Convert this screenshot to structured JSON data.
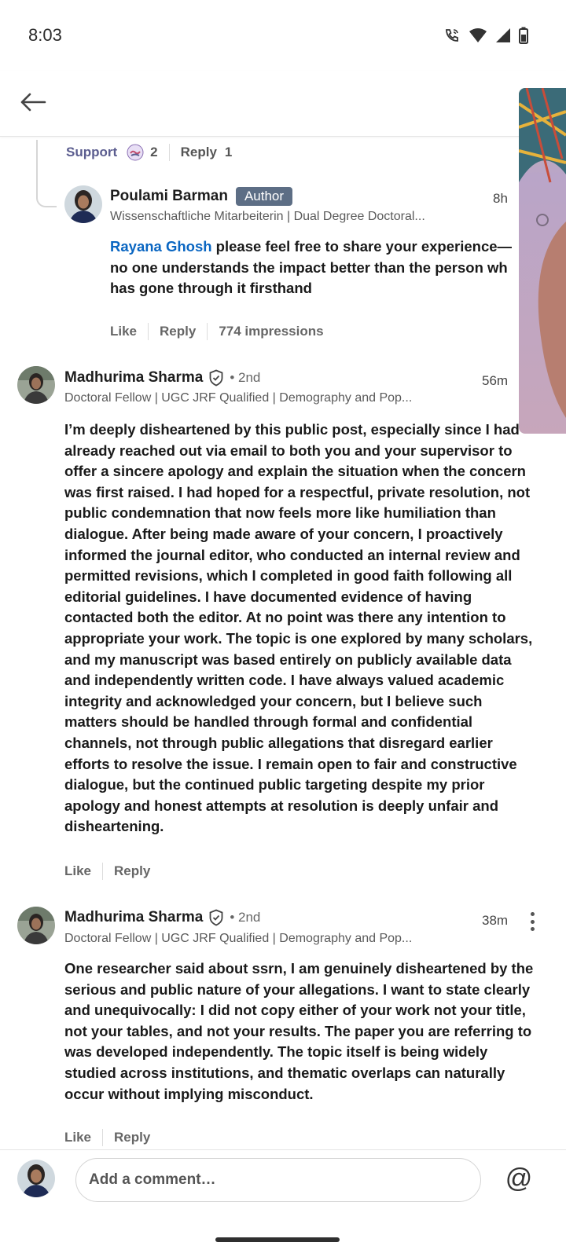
{
  "status_bar": {
    "time": "8:03",
    "icons": [
      "wifi-calling-icon",
      "wifi-icon",
      "signal-icon",
      "battery-icon"
    ]
  },
  "app_bar": {
    "back_icon": "arrow-left-icon"
  },
  "parent_actions": {
    "support_label": "Support",
    "reaction_count": "2",
    "reply_label": "Reply",
    "reply_count": "1"
  },
  "comments": [
    {
      "author": "Poulami Barman",
      "badge": "Author",
      "headline": "Wissenschaftliche Mitarbeiterin | Dual Degree Doctoral...",
      "time": "8h",
      "mention": "Rayana Ghosh",
      "text_line1": " please feel free to share your experience—",
      "text_line2": "no one understands the impact better than the person wh",
      "text_line3": "has gone through it firsthand",
      "actions": {
        "like": "Like",
        "reply": "Reply",
        "impressions": "774 impressions"
      }
    },
    {
      "author": "Madhurima Sharma",
      "degree": "• 2nd",
      "headline": "Doctoral Fellow | UGC JRF Qualified | Demography and Pop...",
      "time": "56m",
      "text": "I’m deeply disheartened by this public post, especially since I had already reached out via email to both you and your supervisor to offer a sincere apology and explain the situation when the concern was first raised. I had hoped for a respectful, private resolution, not public condemnation that now feels more like humiliation than dialogue. After being made aware of your concern, I proactively informed the journal editor, who conducted an internal review and permitted revisions, which I completed in good faith following all editorial guidelines. I have documented evidence of having contacted both the editor. At no point was there any intention to appropriate your work. The topic is one explored by many scholars, and my manuscript was based entirely on publicly available data and independently written code. I have always valued academic integrity and acknowledged your concern, but I believe such matters should be handled through formal and confidential channels, not through public allegations that disregard earlier efforts to resolve the issue. I remain open to fair and constructive dialogue, but the continued public targeting despite my prior apology and honest attempts at resolution is deeply unfair and disheartening.",
      "actions": {
        "like": "Like",
        "reply": "Reply"
      }
    },
    {
      "author": "Madhurima Sharma",
      "degree": "• 2nd",
      "headline": "Doctoral Fellow | UGC JRF Qualified | Demography and Pop...",
      "time": "38m",
      "text": "One researcher said about ssrn, I am genuinely disheartened by the serious and public nature of your allegations. I want to state clearly and unequivocally: I did not copy either of your work not your title, not your tables, and not your results. The paper you are referring to was developed independently. The topic itself is being widely studied across institutions, and thematic overlaps can naturally occur without implying misconduct.",
      "actions": {
        "like": "Like",
        "reply": "Reply"
      }
    }
  ],
  "compose": {
    "placeholder": "Add a comment…",
    "mention_symbol": "@"
  },
  "colors": {
    "mention_blue": "#0a66c2",
    "author_badge": "#5d6e85",
    "support_label": "#5b5d8f"
  }
}
